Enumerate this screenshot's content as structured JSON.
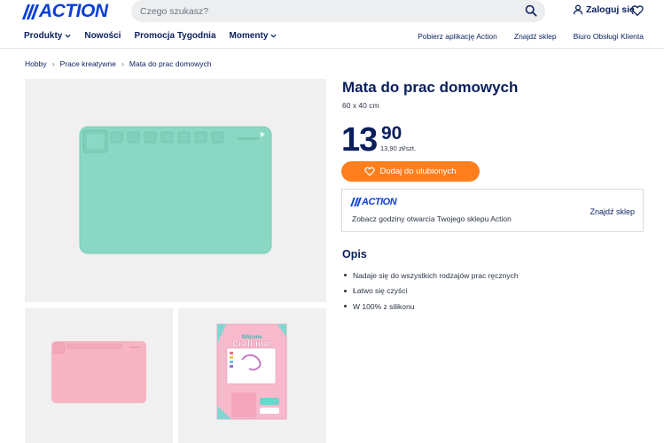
{
  "header": {
    "logo_text": "ACTION",
    "search_placeholder": "Czego szukasz?",
    "login_label": "Zaloguj się"
  },
  "nav": {
    "left": [
      {
        "label": "Produkty",
        "has_dropdown": true
      },
      {
        "label": "Nowości",
        "has_dropdown": false
      },
      {
        "label": "Promocja Tygodnia",
        "has_dropdown": false
      },
      {
        "label": "Momenty",
        "has_dropdown": true
      }
    ],
    "right": [
      {
        "label": "Pobierz aplikację Action"
      },
      {
        "label": "Znajdź sklep"
      },
      {
        "label": "Biuro Obsługi Klienta"
      }
    ]
  },
  "breadcrumb": {
    "items": [
      "Hobby",
      "Prace kreatywne",
      "Mata do prac domowych"
    ],
    "separator": "›"
  },
  "gallery": {
    "main": {
      "mat_color": "#8ad8c4"
    },
    "thumb1": {
      "mat_color": "#f7b4c4"
    },
    "thumb2": {
      "box_title_line1": "Silicone",
      "box_title_line2": "Craft mat",
      "box_color": "#f7b9cc"
    }
  },
  "product": {
    "title": "Mata do prac domowych",
    "size": "60 x 40 cm",
    "price_integer": "13",
    "price_decimal": "90",
    "price_unit": "13,90 zł/szt.",
    "favorite_button": "Dodaj do ulubionych"
  },
  "store": {
    "logo_text": "ACTION",
    "text": "Zobacz godziny otwarcia Twojego sklepu Action",
    "link": "Znajdź sklep"
  },
  "description": {
    "title": "Opis",
    "items": [
      "Nadaje się do wszystkich rodzajów prac ręcznych",
      "Łatwo się czyści",
      "W 100% z silikonu"
    ]
  },
  "colors": {
    "brand_blue": "#0a3fd6",
    "navy": "#0a1f5c",
    "orange": "#ff7f1e"
  }
}
